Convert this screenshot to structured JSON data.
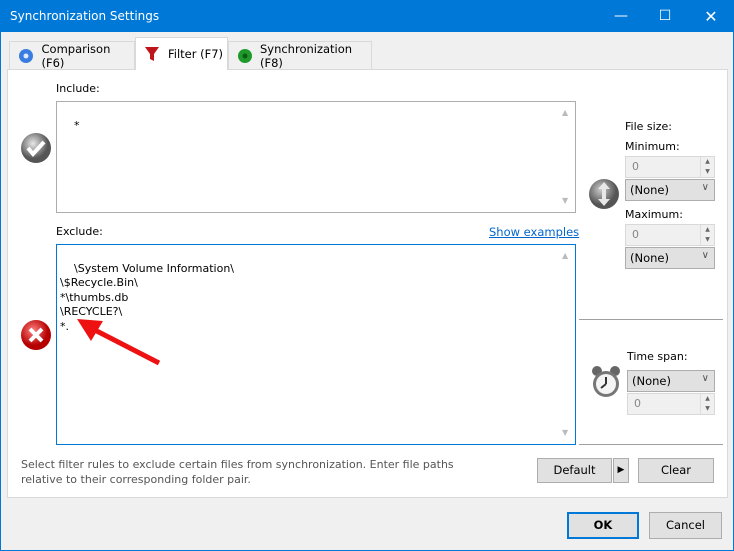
{
  "window": {
    "title": "Synchronization Settings",
    "minimize_icon": "minimize-icon",
    "maximize_icon": "maximize-icon",
    "close_icon": "close-icon",
    "accent": "#0078d7"
  },
  "tabs": [
    {
      "label": "Comparison (F6)",
      "icon": "gear-blue-icon",
      "selected": false
    },
    {
      "label": "Filter (F7)",
      "icon": "funnel-icon",
      "selected": true
    },
    {
      "label": "Synchronization (F8)",
      "icon": "gear-green-icon",
      "selected": false
    }
  ],
  "filter": {
    "include_label": "Include:",
    "include_value": "*",
    "exclude_label": "Exclude:",
    "show_examples": "Show examples",
    "exclude_value": "\\System Volume Information\\\n\\$Recycle.Bin\\\n*\\thumbs.db\n\\RECYCLE?\\\n*.",
    "help_text": "Select filter rules to exclude certain files from synchronization. Enter file paths relative to their corresponding folder pair.",
    "default_button": "Default",
    "clear_button": "Clear"
  },
  "file_size": {
    "label": "File size:",
    "minimum_label": "Minimum:",
    "minimum_value": "0",
    "minimum_unit": "(None)",
    "maximum_label": "Maximum:",
    "maximum_value": "0",
    "maximum_unit": "(None)"
  },
  "time_span": {
    "label": "Time span:",
    "unit": "(None)",
    "value": "0"
  },
  "footer": {
    "ok": "OK",
    "cancel": "Cancel"
  }
}
